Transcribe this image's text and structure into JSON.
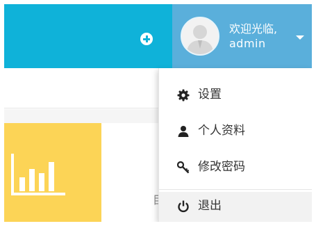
{
  "header": {
    "add_icon": "plus-circle-icon",
    "user": {
      "welcome": "欢迎光临,",
      "username": "admin",
      "avatar_icon": "user-avatar-icon",
      "caret_icon": "caret-down-icon"
    },
    "colors": {
      "primary": "#0fb2d9",
      "user_area": "#5aafdb"
    }
  },
  "stat_card": {
    "icon": "bar-chart-icon",
    "color": "#fcd456",
    "partial_text": "目"
  },
  "user_menu": {
    "items": [
      {
        "label": "设置",
        "icon": "gear-icon"
      },
      {
        "label": "个人资料",
        "icon": "user-icon"
      },
      {
        "label": "修改密码",
        "icon": "key-icon"
      },
      {
        "label": "退出",
        "icon": "power-icon"
      }
    ]
  }
}
